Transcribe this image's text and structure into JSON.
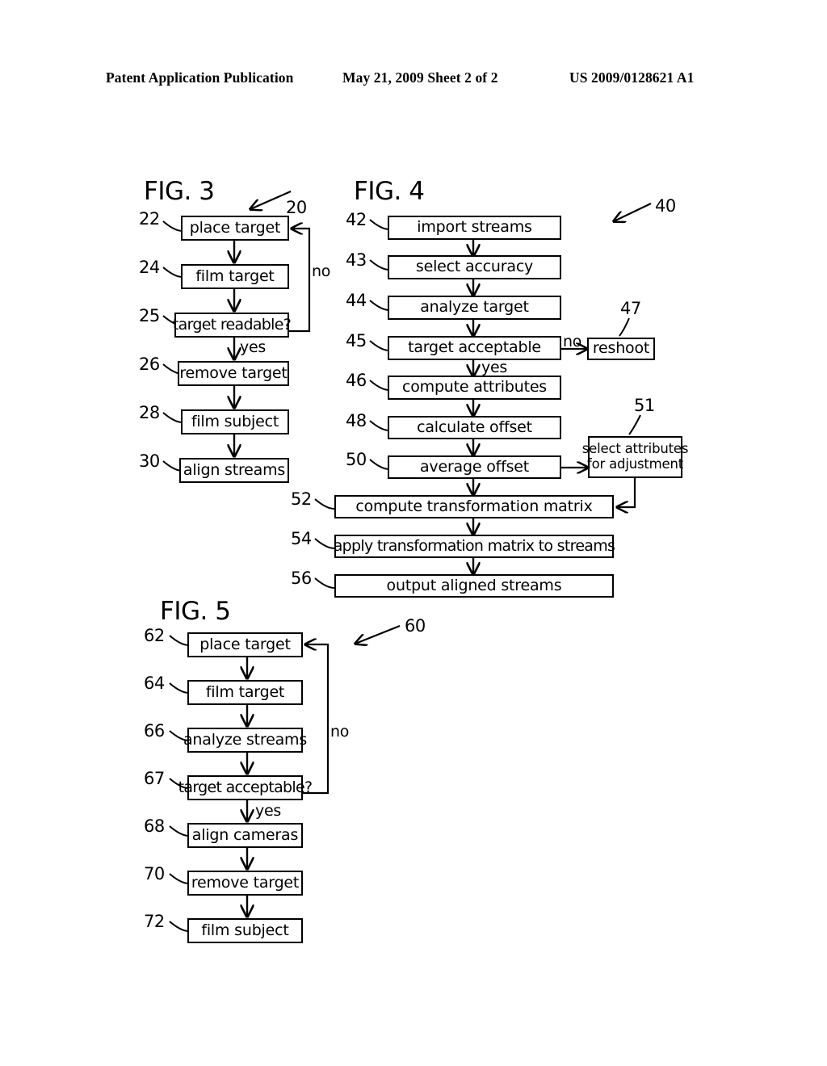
{
  "header": {
    "left": "Patent Application Publication",
    "middle": "May 21, 2009  Sheet 2 of 2",
    "right": "US 2009/0128621 A1"
  },
  "figures": [
    {
      "id": "fig3",
      "title": "FIG. 3",
      "system_ref": "20",
      "boxes": [
        {
          "ref": "22",
          "label": "place target"
        },
        {
          "ref": "24",
          "label": "film target"
        },
        {
          "ref": "25",
          "label": "target readable?"
        },
        {
          "ref": "26",
          "label": "remove target"
        },
        {
          "ref": "28",
          "label": "film subject"
        },
        {
          "ref": "30",
          "label": "align streams"
        }
      ],
      "edge_labels": {
        "no": "no",
        "yes": "yes"
      }
    },
    {
      "id": "fig4",
      "title": "FIG. 4",
      "system_ref": "40",
      "boxes": [
        {
          "ref": "42",
          "label": "import streams"
        },
        {
          "ref": "43",
          "label": "select accuracy"
        },
        {
          "ref": "44",
          "label": "analyze target"
        },
        {
          "ref": "45",
          "label": "target acceptable"
        },
        {
          "ref": "46",
          "label": "compute attributes"
        },
        {
          "ref": "48",
          "label": "calculate offset"
        },
        {
          "ref": "50",
          "label": "average offset"
        },
        {
          "ref": "52",
          "label": "compute transformation matrix"
        },
        {
          "ref": "54",
          "label": "apply transformation matrix to streams"
        },
        {
          "ref": "56",
          "label": "output aligned streams"
        }
      ],
      "side_boxes": [
        {
          "ref": "47",
          "label": "reshoot"
        },
        {
          "ref": "51",
          "label_line1": "select attributes",
          "label_line2": "for adjustment"
        }
      ],
      "edge_labels": {
        "no": "no",
        "yes": "yes"
      }
    },
    {
      "id": "fig5",
      "title": "FIG. 5",
      "system_ref": "60",
      "boxes": [
        {
          "ref": "62",
          "label": "place target"
        },
        {
          "ref": "64",
          "label": "film target"
        },
        {
          "ref": "66",
          "label": "analyze streams"
        },
        {
          "ref": "67",
          "label": "target acceptable?"
        },
        {
          "ref": "68",
          "label": "align cameras"
        },
        {
          "ref": "70",
          "label": "remove target"
        },
        {
          "ref": "72",
          "label": "film subject"
        }
      ],
      "edge_labels": {
        "no": "no",
        "yes": "yes"
      }
    }
  ],
  "colors": {
    "ink": "#000000",
    "paper": "#ffffff"
  }
}
